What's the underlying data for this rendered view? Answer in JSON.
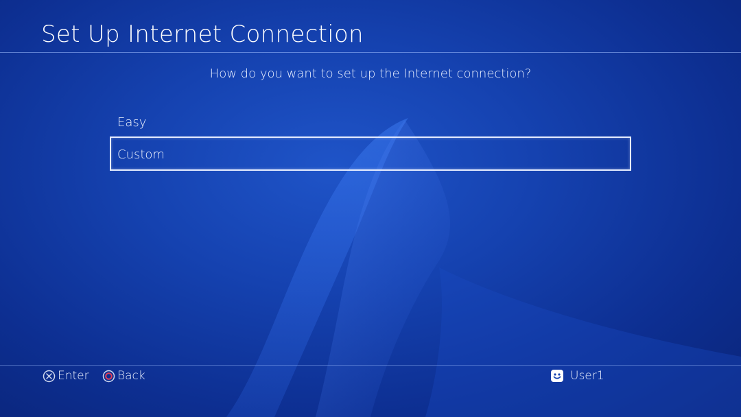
{
  "header": {
    "title": "Set Up Internet Connection"
  },
  "prompt": {
    "question": "How do you want to set up the Internet connection?"
  },
  "options": [
    {
      "label": "Easy",
      "selected": false
    },
    {
      "label": "Custom",
      "selected": true
    }
  ],
  "footer": {
    "enter_label": "Enter",
    "back_label": "Back",
    "enter_icon": "cross-button-icon",
    "back_icon": "circle-button-icon"
  },
  "user": {
    "name": "User1",
    "avatar_icon": "smiley-avatar-icon"
  },
  "colors": {
    "background": "#1542b0",
    "highlight_border": "#e6edff",
    "circle_button": "#e0405a"
  }
}
